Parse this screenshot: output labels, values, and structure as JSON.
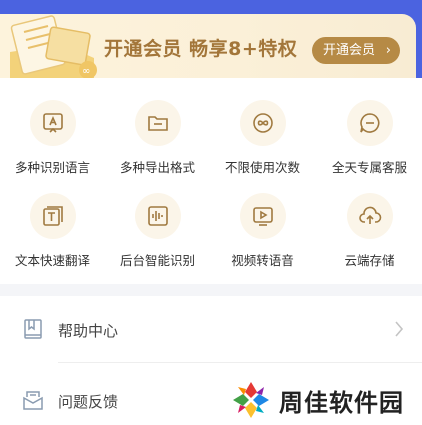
{
  "vip": {
    "promo_text": "开通会员 畅享8+特权",
    "button_label": "开通会员"
  },
  "features": [
    {
      "label": "多种识别语言",
      "icon": "text-recognition-icon"
    },
    {
      "label": "多种导出格式",
      "icon": "folder-icon"
    },
    {
      "label": "不限使用次数",
      "icon": "infinity-icon"
    },
    {
      "label": "全天专属客服",
      "icon": "chat-bubble-icon"
    },
    {
      "label": "文本快速翻译",
      "icon": "text-translate-icon"
    },
    {
      "label": "后台智能识别",
      "icon": "audio-wave-icon"
    },
    {
      "label": "视频转语音",
      "icon": "video-play-icon"
    },
    {
      "label": "云端存储",
      "icon": "cloud-upload-icon"
    }
  ],
  "menu": [
    {
      "label": "帮助中心",
      "icon": "book-icon"
    },
    {
      "label": "问题反馈",
      "icon": "mail-icon"
    }
  ],
  "watermark": {
    "text": "周佳软件园"
  },
  "colors": {
    "brand_blue": "#4b63e0",
    "gold": "#b68a45",
    "gold_text": "#a3763a",
    "icon_bg": "#fbf5e9"
  }
}
